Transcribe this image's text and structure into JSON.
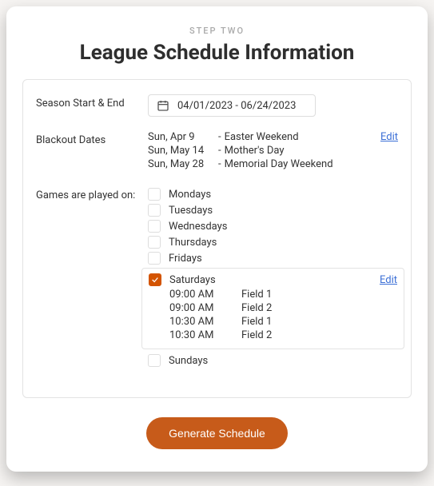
{
  "step_label": "STEP TWO",
  "title": "League Schedule Information",
  "season": {
    "label": "Season Start & End",
    "value": "04/01/2023 - 06/24/2023"
  },
  "blackout": {
    "label": "Blackout Dates",
    "edit": "Edit",
    "items": [
      {
        "date": "Sun, Apr 9",
        "name": "Easter Weekend"
      },
      {
        "date": "Sun, May 14",
        "name": "Mother's Day"
      },
      {
        "date": "Sun, May 28",
        "name": "Memorial Day Weekend"
      }
    ]
  },
  "games": {
    "label": "Games are played on:",
    "days": {
      "mon": "Mondays",
      "tue": "Tuesdays",
      "wed": "Wednesdays",
      "thu": "Thursdays",
      "fri": "Fridays",
      "sat": "Saturdays",
      "sun": "Sundays"
    },
    "saturday_edit": "Edit",
    "saturday_slots": [
      {
        "time": "09:00 AM",
        "field": "Field 1"
      },
      {
        "time": "09:00 AM",
        "field": "Field 2"
      },
      {
        "time": "10:30 AM",
        "field": "Field 1"
      },
      {
        "time": "10:30 AM",
        "field": "Field 2"
      }
    ]
  },
  "generate_label": "Generate Schedule"
}
